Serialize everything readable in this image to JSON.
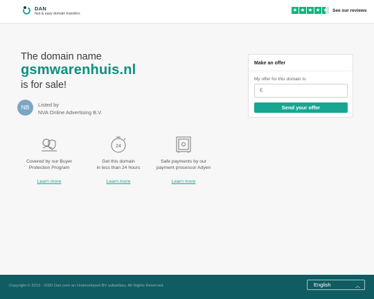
{
  "header": {
    "logo_name": "DAN",
    "logo_tagline": "fast & easy domain transfers",
    "reviews_label": "See our reviews",
    "rating_stars": 4.5
  },
  "main": {
    "headline": "The domain name",
    "domain": "gsmwarenhuis.nl",
    "for_sale": "is for sale!",
    "avatar_initials": "NB",
    "listed_by_label": "Listed by",
    "seller_name": "NVA Online Advertising B.V."
  },
  "offer": {
    "title": "Make an offer",
    "field_label": "My offer for this domain is:",
    "currency_symbol": "€",
    "submit_label": "Send your offer"
  },
  "features": [
    {
      "icon": "buyer-protection-icon",
      "line1": "Covered by our Buyer",
      "line2": "Protection Program",
      "link": "Learn more"
    },
    {
      "icon": "24h-transfer-icon",
      "line1": "Get this domain",
      "line2": "in less than 24 hours",
      "link": "Learn more"
    },
    {
      "icon": "safe-payment-icon",
      "line1": "Safe payments by our",
      "line2": "payment processor Adyen",
      "link": "Learn more"
    }
  ],
  "footer": {
    "copyright": "Copyright © 2013 - 2020 Dan.com an Undeveloped BV subsidiary. All Rights Reserved.",
    "language": "English"
  },
  "colors": {
    "brand_teal": "#16a691",
    "footer_bg": "#0f5c62",
    "trustpilot_green": "#00b67a"
  }
}
